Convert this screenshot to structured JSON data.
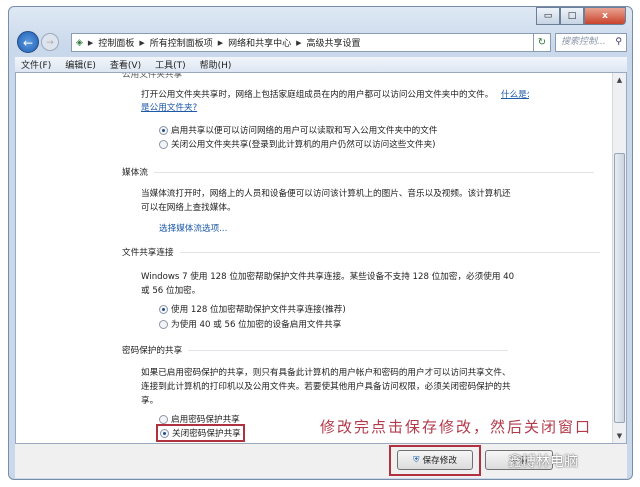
{
  "window": {
    "controls": {
      "minimize": "▭",
      "maximize": "□",
      "close": "x"
    }
  },
  "address": {
    "breadcrumbs": [
      "控制面板",
      "所有控制面板项",
      "网络和共享中心",
      "高级共享设置"
    ],
    "search_placeholder": "搜索控制..."
  },
  "menu": [
    "文件(F)",
    "编辑(E)",
    "查看(V)",
    "工具(T)",
    "帮助(H)"
  ],
  "public_folder": {
    "partial_heading": "公用文件夹共享",
    "description": "打开公用文件夹共享时，网络上包括家庭组成员在内的用户都可以访问公用文件夹中的文件。",
    "link": "什么是公用文件夹?",
    "options": [
      {
        "label": "启用共享以便可以访问网络的用户可以读取和写入公用文件夹中的文件",
        "selected": true
      },
      {
        "label": "关闭公用文件夹共享(登录到此计算机的用户仍然可以访问这些文件夹)",
        "selected": false
      }
    ]
  },
  "media": {
    "heading": "媒体流",
    "line1": "当媒体流打开时，网络上的人员和设备便可以访问该计算机上的图片、音乐以及视频。该计算机还",
    "line2": "可以在网络上查找媒体。",
    "link": "选择媒体流选项..."
  },
  "file_sharing": {
    "heading": "文件共享连接",
    "line1": "Windows 7 使用 128 位加密帮助保护文件共享连接。某些设备不支持 128 位加密，必须使用 40",
    "line2": "或 56 位加密。",
    "options": [
      {
        "label": "使用 128 位加密帮助保护文件共享连接(推荐)",
        "selected": true
      },
      {
        "label": "为使用 40 或 56 位加密的设备启用文件共享",
        "selected": false
      }
    ]
  },
  "password": {
    "heading": "密码保护的共享",
    "line1": "如果已启用密码保护的共享，则只有具备此计算机的用户帐户和密码的用户才可以访问共享文件、",
    "line2": "连接到此计算机的打印机以及公用文件夹。若要使其他用户具备访问权限，必须关闭密码保护的共",
    "line3": "享。",
    "options": [
      {
        "label": "启用密码保护共享",
        "selected": false
      },
      {
        "label": "关闭密码保护共享",
        "selected": true
      }
    ]
  },
  "buttons": {
    "save": "保存修改",
    "cancel": "取消"
  },
  "annotation": "修改完点击保存修改，然后关闭窗口",
  "watermark": "鑫博林电脑",
  "colors": {
    "highlight": "#b0313f",
    "link": "#1d5aa8"
  }
}
